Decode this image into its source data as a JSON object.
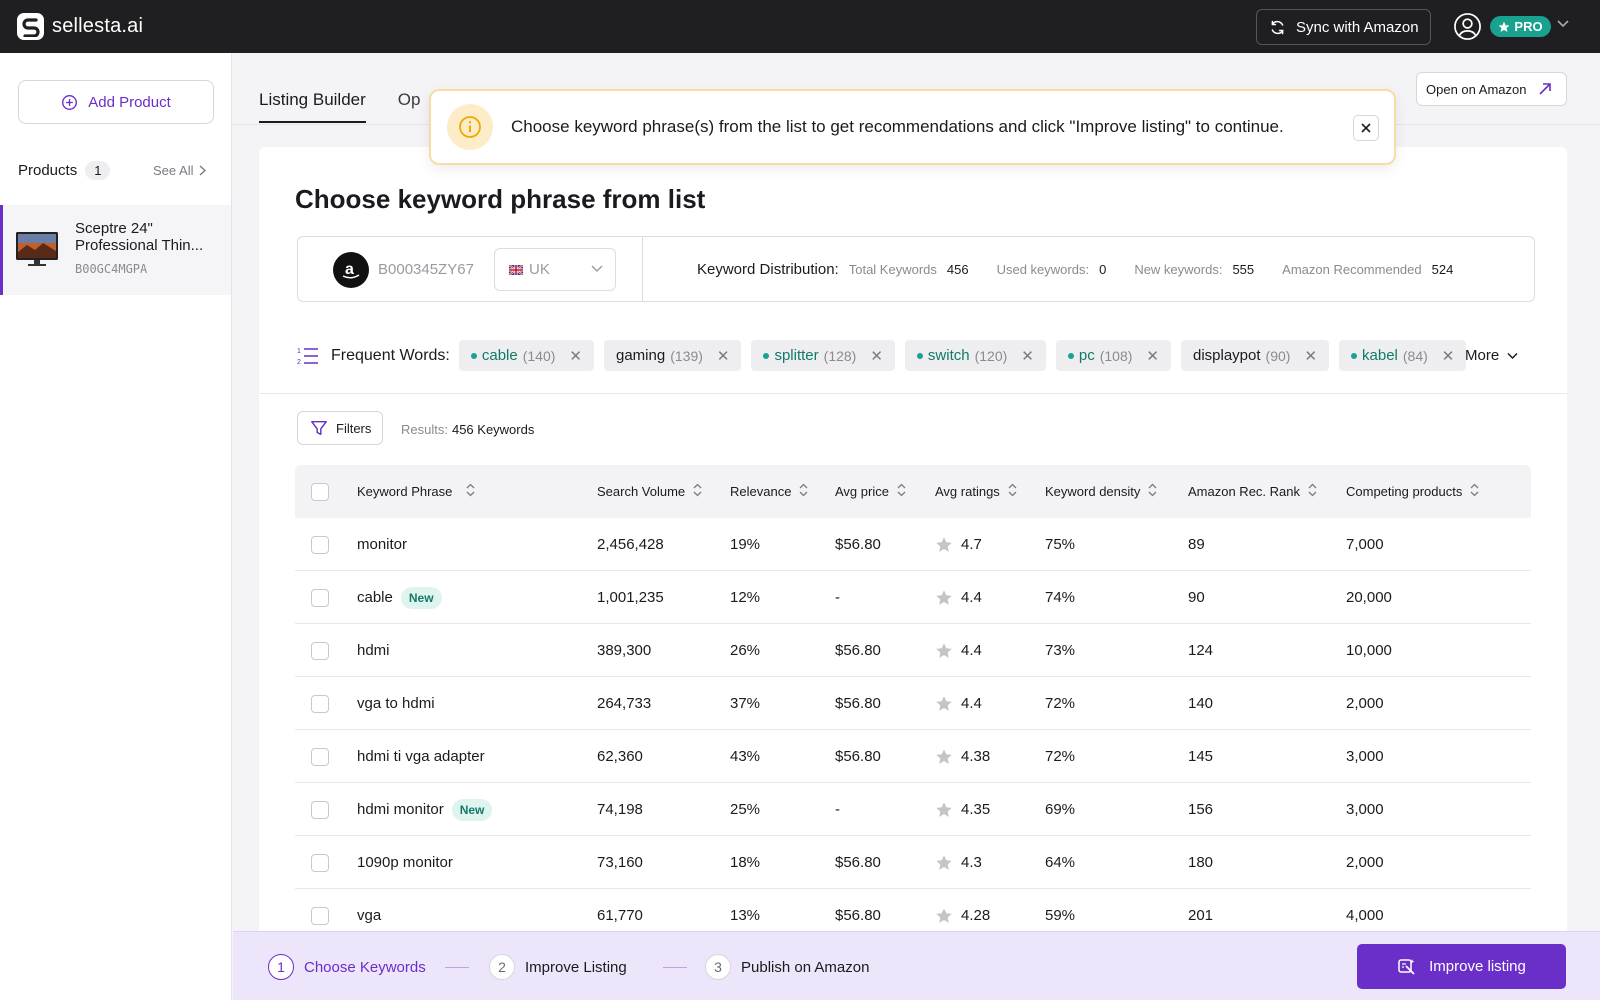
{
  "app": {
    "brand": "sellesta.ai"
  },
  "topbar": {
    "sync_label": "Sync with Amazon",
    "pro_label": "PRO"
  },
  "sidebar": {
    "add_product_label": "Add Product",
    "products_label": "Products",
    "products_count": "1",
    "see_all_label": "See All",
    "product": {
      "name": "Sceptre 24\" Professional Thin...",
      "asin": "B00GC4MGPA"
    }
  },
  "tabs": {
    "active": "Listing Builder",
    "second": "Op"
  },
  "open_amazon_label": "Open on Amazon",
  "toast": {
    "message": "Choose keyword phrase(s) from the list to get recommendations and click \"Improve listing\" to continue."
  },
  "main": {
    "title": "Choose keyword phrase from list",
    "asin": "B000345ZY67",
    "country": "UK",
    "keyword_distribution": {
      "title": "Keyword Distribution:",
      "total_label": "Total Keywords",
      "total": "456",
      "used_label": "Used keywords:",
      "used": "0",
      "new_label": "New keywords:",
      "new": "555",
      "recommended_label": "Amazon Recommended",
      "recommended": "524"
    },
    "frequent_words_label": "Frequent Words:",
    "frequent_words": [
      {
        "word": "cable",
        "count": "(140)",
        "highlight": true
      },
      {
        "word": "gaming",
        "count": "(139)",
        "highlight": false
      },
      {
        "word": "splitter",
        "count": "(128)",
        "highlight": true
      },
      {
        "word": "switch",
        "count": "(120)",
        "highlight": true
      },
      {
        "word": "pc",
        "count": "(108)",
        "highlight": true
      },
      {
        "word": "displaypot",
        "count": "(90)",
        "highlight": false
      },
      {
        "word": "kabel",
        "count": "(84)",
        "highlight": true
      }
    ],
    "more_label": "More",
    "filters_label": "Filters",
    "results_label": "Results:",
    "results_value": "456 Keywords",
    "columns": [
      "Keyword Phrase",
      "Search Volume",
      "Relevance",
      "Avg price",
      "Avg ratings",
      "Keyword density",
      "Amazon Rec. Rank",
      "Competing products"
    ],
    "new_badge_label": "New",
    "rows": [
      {
        "keyword": "monitor",
        "is_new": false,
        "volume": "2,456,428",
        "relevance": "19%",
        "price": "$56.80",
        "rating": "4.7",
        "density": "75%",
        "rank": "89",
        "competing": "7,000"
      },
      {
        "keyword": "cable",
        "is_new": true,
        "volume": "1,001,235",
        "relevance": "12%",
        "price": "-",
        "rating": "4.4",
        "density": "74%",
        "rank": "90",
        "competing": "20,000"
      },
      {
        "keyword": "hdmi",
        "is_new": false,
        "volume": "389,300",
        "relevance": "26%",
        "price": "$56.80",
        "rating": "4.4",
        "density": "73%",
        "rank": "124",
        "competing": "10,000"
      },
      {
        "keyword": "vga to hdmi",
        "is_new": false,
        "volume": "264,733",
        "relevance": "37%",
        "price": "$56.80",
        "rating": "4.4",
        "density": "72%",
        "rank": "140",
        "competing": "2,000"
      },
      {
        "keyword": "hdmi ti vga adapter",
        "is_new": false,
        "volume": "62,360",
        "relevance": "43%",
        "price": "$56.80",
        "rating": "4.38",
        "density": "72%",
        "rank": "145",
        "competing": "3,000"
      },
      {
        "keyword": "hdmi monitor",
        "is_new": true,
        "volume": "74,198",
        "relevance": "25%",
        "price": "-",
        "rating": "4.35",
        "density": "69%",
        "rank": "156",
        "competing": "3,000"
      },
      {
        "keyword": "1090p monitor",
        "is_new": false,
        "volume": "73,160",
        "relevance": "18%",
        "price": "$56.80",
        "rating": "4.3",
        "density": "64%",
        "rank": "180",
        "competing": "2,000"
      },
      {
        "keyword": "vga",
        "is_new": false,
        "volume": "61,770",
        "relevance": "13%",
        "price": "$56.80",
        "rating": "4.28",
        "density": "59%",
        "rank": "201",
        "competing": "4,000"
      }
    ]
  },
  "steps": [
    {
      "num": "1",
      "label": "Choose Keywords",
      "active": true
    },
    {
      "num": "2",
      "label": "Improve Listing",
      "active": false
    },
    {
      "num": "3",
      "label": "Publish on Amazon",
      "active": false
    }
  ],
  "improve_button_label": "Improve listing",
  "colors": {
    "accent": "#6a2ec9",
    "teal": "#18a28f",
    "topbar": "#1f1f21"
  }
}
